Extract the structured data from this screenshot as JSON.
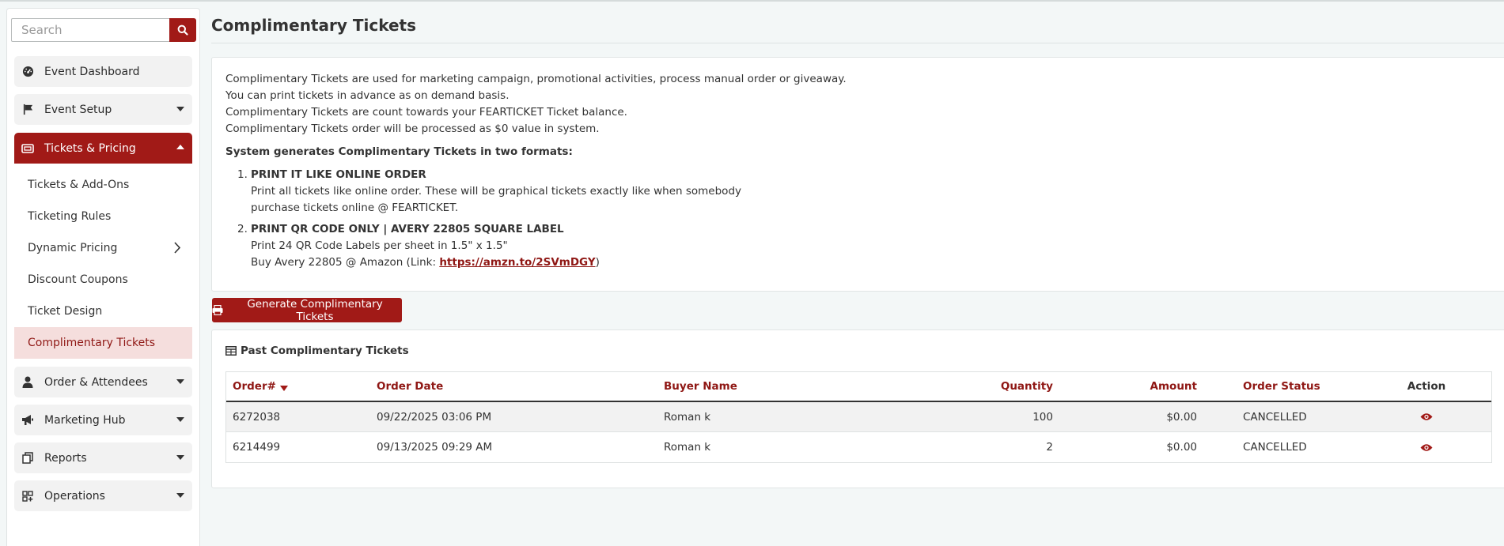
{
  "search": {
    "placeholder": "Search"
  },
  "sidebar": {
    "items": [
      {
        "label": "Event Dashboard",
        "icon": "gauge-icon"
      },
      {
        "label": "Event Setup",
        "icon": "flag-icon"
      },
      {
        "label": "Tickets & Pricing",
        "icon": "ticket-icon"
      },
      {
        "label": "Order & Attendees",
        "icon": "user-icon"
      },
      {
        "label": "Marketing Hub",
        "icon": "bullhorn-icon"
      },
      {
        "label": "Reports",
        "icon": "copy-icon"
      },
      {
        "label": "Operations",
        "icon": "grid-plus-icon"
      }
    ],
    "submenu": [
      {
        "label": "Tickets & Add-Ons"
      },
      {
        "label": "Ticketing Rules"
      },
      {
        "label": "Dynamic Pricing"
      },
      {
        "label": "Discount Coupons"
      },
      {
        "label": "Ticket Design"
      },
      {
        "label": "Complimentary Tickets"
      }
    ]
  },
  "page": {
    "title": "Complimentary Tickets",
    "info_lines": [
      "Complimentary Tickets are used for marketing campaign, promotional activities, process manual order or giveaway.",
      "You can print tickets in advance as on demand basis.",
      "Complimentary Tickets are count towards your FEARTICKET Ticket balance.",
      "Complimentary Tickets order will be processed as $0 value in system."
    ],
    "formats_heading": "System generates Complimentary Tickets in two formats:",
    "format1": {
      "num": "1.",
      "title": "PRINT IT LIKE ONLINE ORDER",
      "line1": "Print all tickets like online order. These will be graphical tickets exactly like when somebody",
      "line2": "purchase tickets online @ FEARTICKET."
    },
    "format2": {
      "num": "2.",
      "title": "PRINT QR CODE ONLY | AVERY 22805 SQUARE LABEL",
      "line1": "Print 24 QR Code Labels per sheet in 1.5\" x 1.5\"",
      "line2_prefix": "Buy Avery 22805 @ Amazon (Link: ",
      "link": "https://amzn.to/2SVmDGY",
      "line2_suffix": ")"
    },
    "generate_button": "Generate Complimentary Tickets",
    "past_heading": "Past Complimentary Tickets"
  },
  "table": {
    "headers": {
      "order": "Order#",
      "date": "Order Date",
      "buyer": "Buyer Name",
      "quantity": "Quantity",
      "amount": "Amount",
      "status": "Order Status",
      "action": "Action"
    },
    "rows": [
      {
        "order": "6272038",
        "date": "09/22/2025 03:06 PM",
        "buyer": "Roman k",
        "quantity": "100",
        "amount": "$0.00",
        "status": "CANCELLED"
      },
      {
        "order": "6214499",
        "date": "09/13/2025 09:29 AM",
        "buyer": "Roman k",
        "quantity": "2",
        "amount": "$0.00",
        "status": "CANCELLED"
      }
    ]
  },
  "colors": {
    "accent": "#a11a17",
    "accent_light": "#f5dedd",
    "background": "#f3f7f7"
  }
}
